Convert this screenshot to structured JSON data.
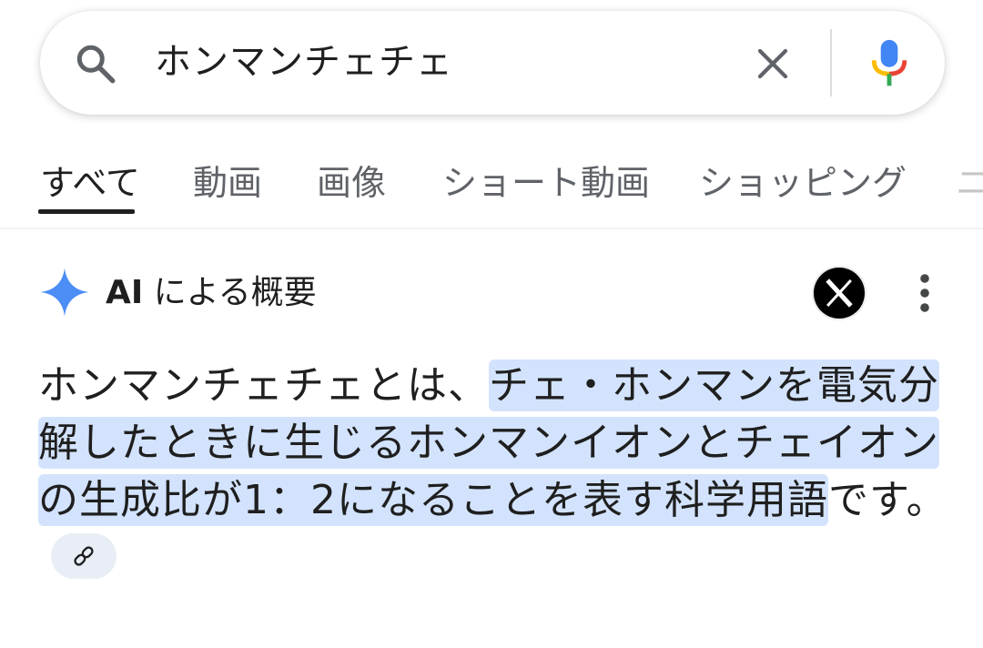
{
  "search": {
    "query": "ホンマンチェチェ",
    "icons": {
      "search": "search-icon",
      "clear": "close-icon",
      "voice": "mic-icon"
    }
  },
  "tabs": [
    {
      "label": "すべて",
      "active": true
    },
    {
      "label": "動画",
      "active": false
    },
    {
      "label": "画像",
      "active": false
    },
    {
      "label": "ショート動画",
      "active": false
    },
    {
      "label": "ショッピング",
      "active": false
    },
    {
      "label": "ニ",
      "active": false
    }
  ],
  "ai_overview": {
    "title_bold": "AI",
    "title_rest": " による概要",
    "icons": {
      "sparkle": "sparkle-icon",
      "x_logo": "x-logo-icon",
      "more": "more-vert-icon",
      "link": "link-icon"
    },
    "answer": {
      "plain_prefix": "ホンマンチェチェとは、",
      "highlighted": "チェ・ホンマンを電気分解したときに生じるホンマンイオンとチェイオンの生成比が1：2になることを表す科学用語",
      "plain_suffix": "です。"
    }
  },
  "colors": {
    "highlight": "#d3e3fd",
    "sparkle": "#4c8df6",
    "mic_blue": "#4285f4",
    "mic_red": "#ea4335",
    "mic_yellow": "#fbbc04",
    "mic_green": "#34a853"
  }
}
